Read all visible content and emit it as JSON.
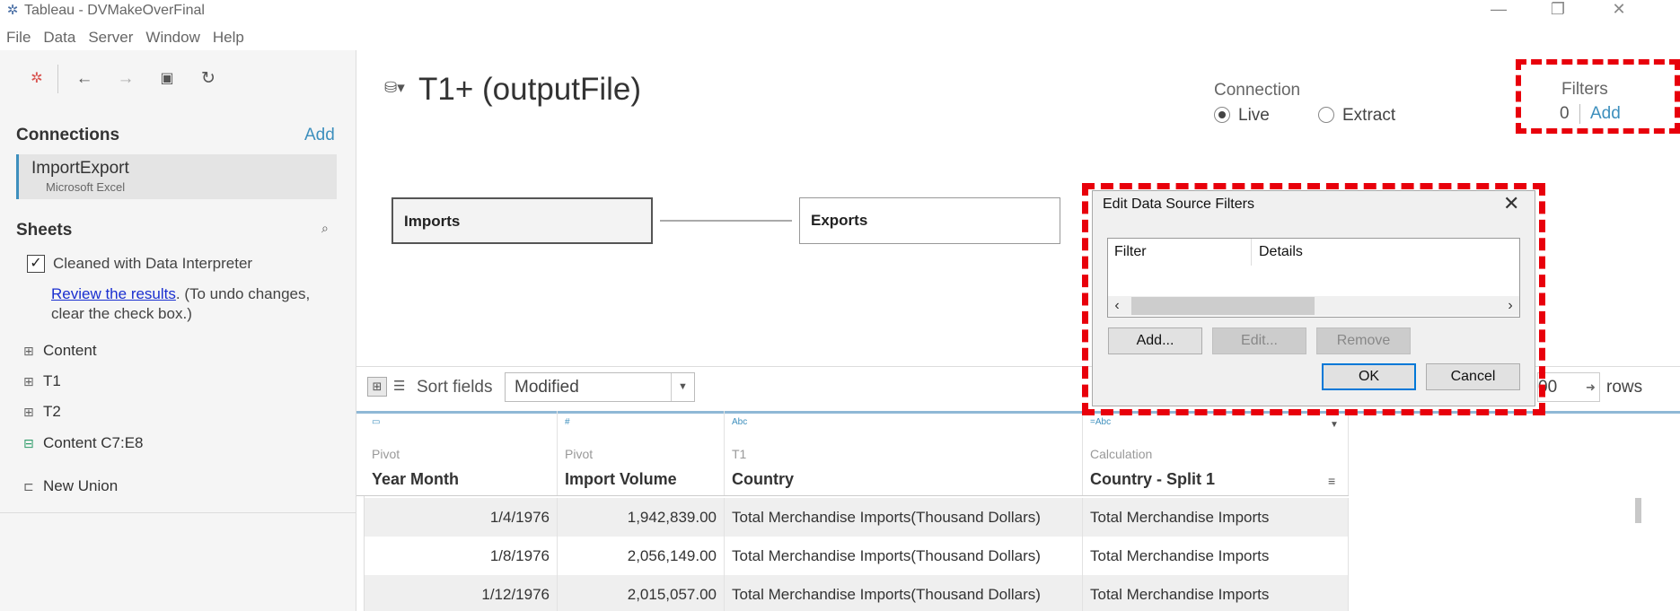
{
  "window": {
    "title": "Tableau - DVMakeOverFinal",
    "minimize_glyph": "—",
    "restore_glyph": "❐",
    "close_glyph": "✕"
  },
  "menu": [
    "File",
    "Data",
    "Server",
    "Window",
    "Help"
  ],
  "toolbar": {
    "icons": [
      "tableau-logo-icon",
      "back-icon",
      "forward-icon",
      "save-icon",
      "refresh-icon"
    ],
    "glyphs": [
      "✲",
      "←",
      "→",
      "▣",
      "↻"
    ]
  },
  "connections": {
    "title": "Connections",
    "add_label": "Add",
    "items": [
      {
        "name": "ImportExport",
        "type": "Microsoft Excel"
      }
    ]
  },
  "sheets": {
    "title": "Sheets",
    "interpreter_checked": true,
    "interpreter_label": "Cleaned with Data Interpreter",
    "review_link": "Review the results",
    "review_rest": ". (To undo changes, clear the check box.)",
    "items": [
      {
        "label": "Content",
        "icon": "table-icon"
      },
      {
        "label": "T1",
        "icon": "table-icon"
      },
      {
        "label": "T2",
        "icon": "table-icon"
      },
      {
        "label": "Content C7:E8",
        "icon": "named-range-icon"
      }
    ],
    "new_union": "New Union"
  },
  "datasource": {
    "title": "T1+ (outputFile)"
  },
  "connection_mode": {
    "label": "Connection",
    "options": [
      "Live",
      "Extract"
    ],
    "selected": "Live"
  },
  "filters": {
    "label": "Filters",
    "count": "0",
    "add_label": "Add"
  },
  "canvas": {
    "tables": [
      "Imports",
      "Exports"
    ]
  },
  "grid_toolbar": {
    "sort_label": "Sort fields",
    "sort_value": "Modified",
    "rows_value": "00",
    "rows_label": "rows"
  },
  "grid": {
    "columns": [
      {
        "type": "date-icon",
        "type_glyph": "▭",
        "source": "Pivot",
        "name": "Year Month"
      },
      {
        "type": "number-icon",
        "type_glyph": "#",
        "source": "Pivot",
        "name": "Import Volume"
      },
      {
        "type": "string-icon",
        "type_glyph": "Abc",
        "source": "T1",
        "name": "Country"
      },
      {
        "type": "calc-string-icon",
        "type_glyph": "=Abc",
        "source": "Calculation",
        "name": "Country - Split 1"
      }
    ],
    "rows": [
      [
        "1/4/1976",
        "1,942,839.00",
        "Total Merchandise Imports(Thousand Dollars)",
        "Total Merchandise Imports"
      ],
      [
        "1/8/1976",
        "2,056,149.00",
        "Total Merchandise Imports(Thousand Dollars)",
        "Total Merchandise Imports"
      ],
      [
        "1/12/1976",
        "2,015,057.00",
        "Total Merchandise Imports(Thousand Dollars)",
        "Total Merchandise Imports"
      ]
    ]
  },
  "dialog": {
    "title": "Edit Data Source Filters",
    "columns": [
      "Filter",
      "Details"
    ],
    "buttons": {
      "add": "Add...",
      "edit": "Edit...",
      "remove": "Remove",
      "ok": "OK",
      "cancel": "Cancel"
    }
  },
  "colors": {
    "accent": "#3d8fbd",
    "highlight": "#e8000b",
    "link": "#1a2fd0"
  }
}
